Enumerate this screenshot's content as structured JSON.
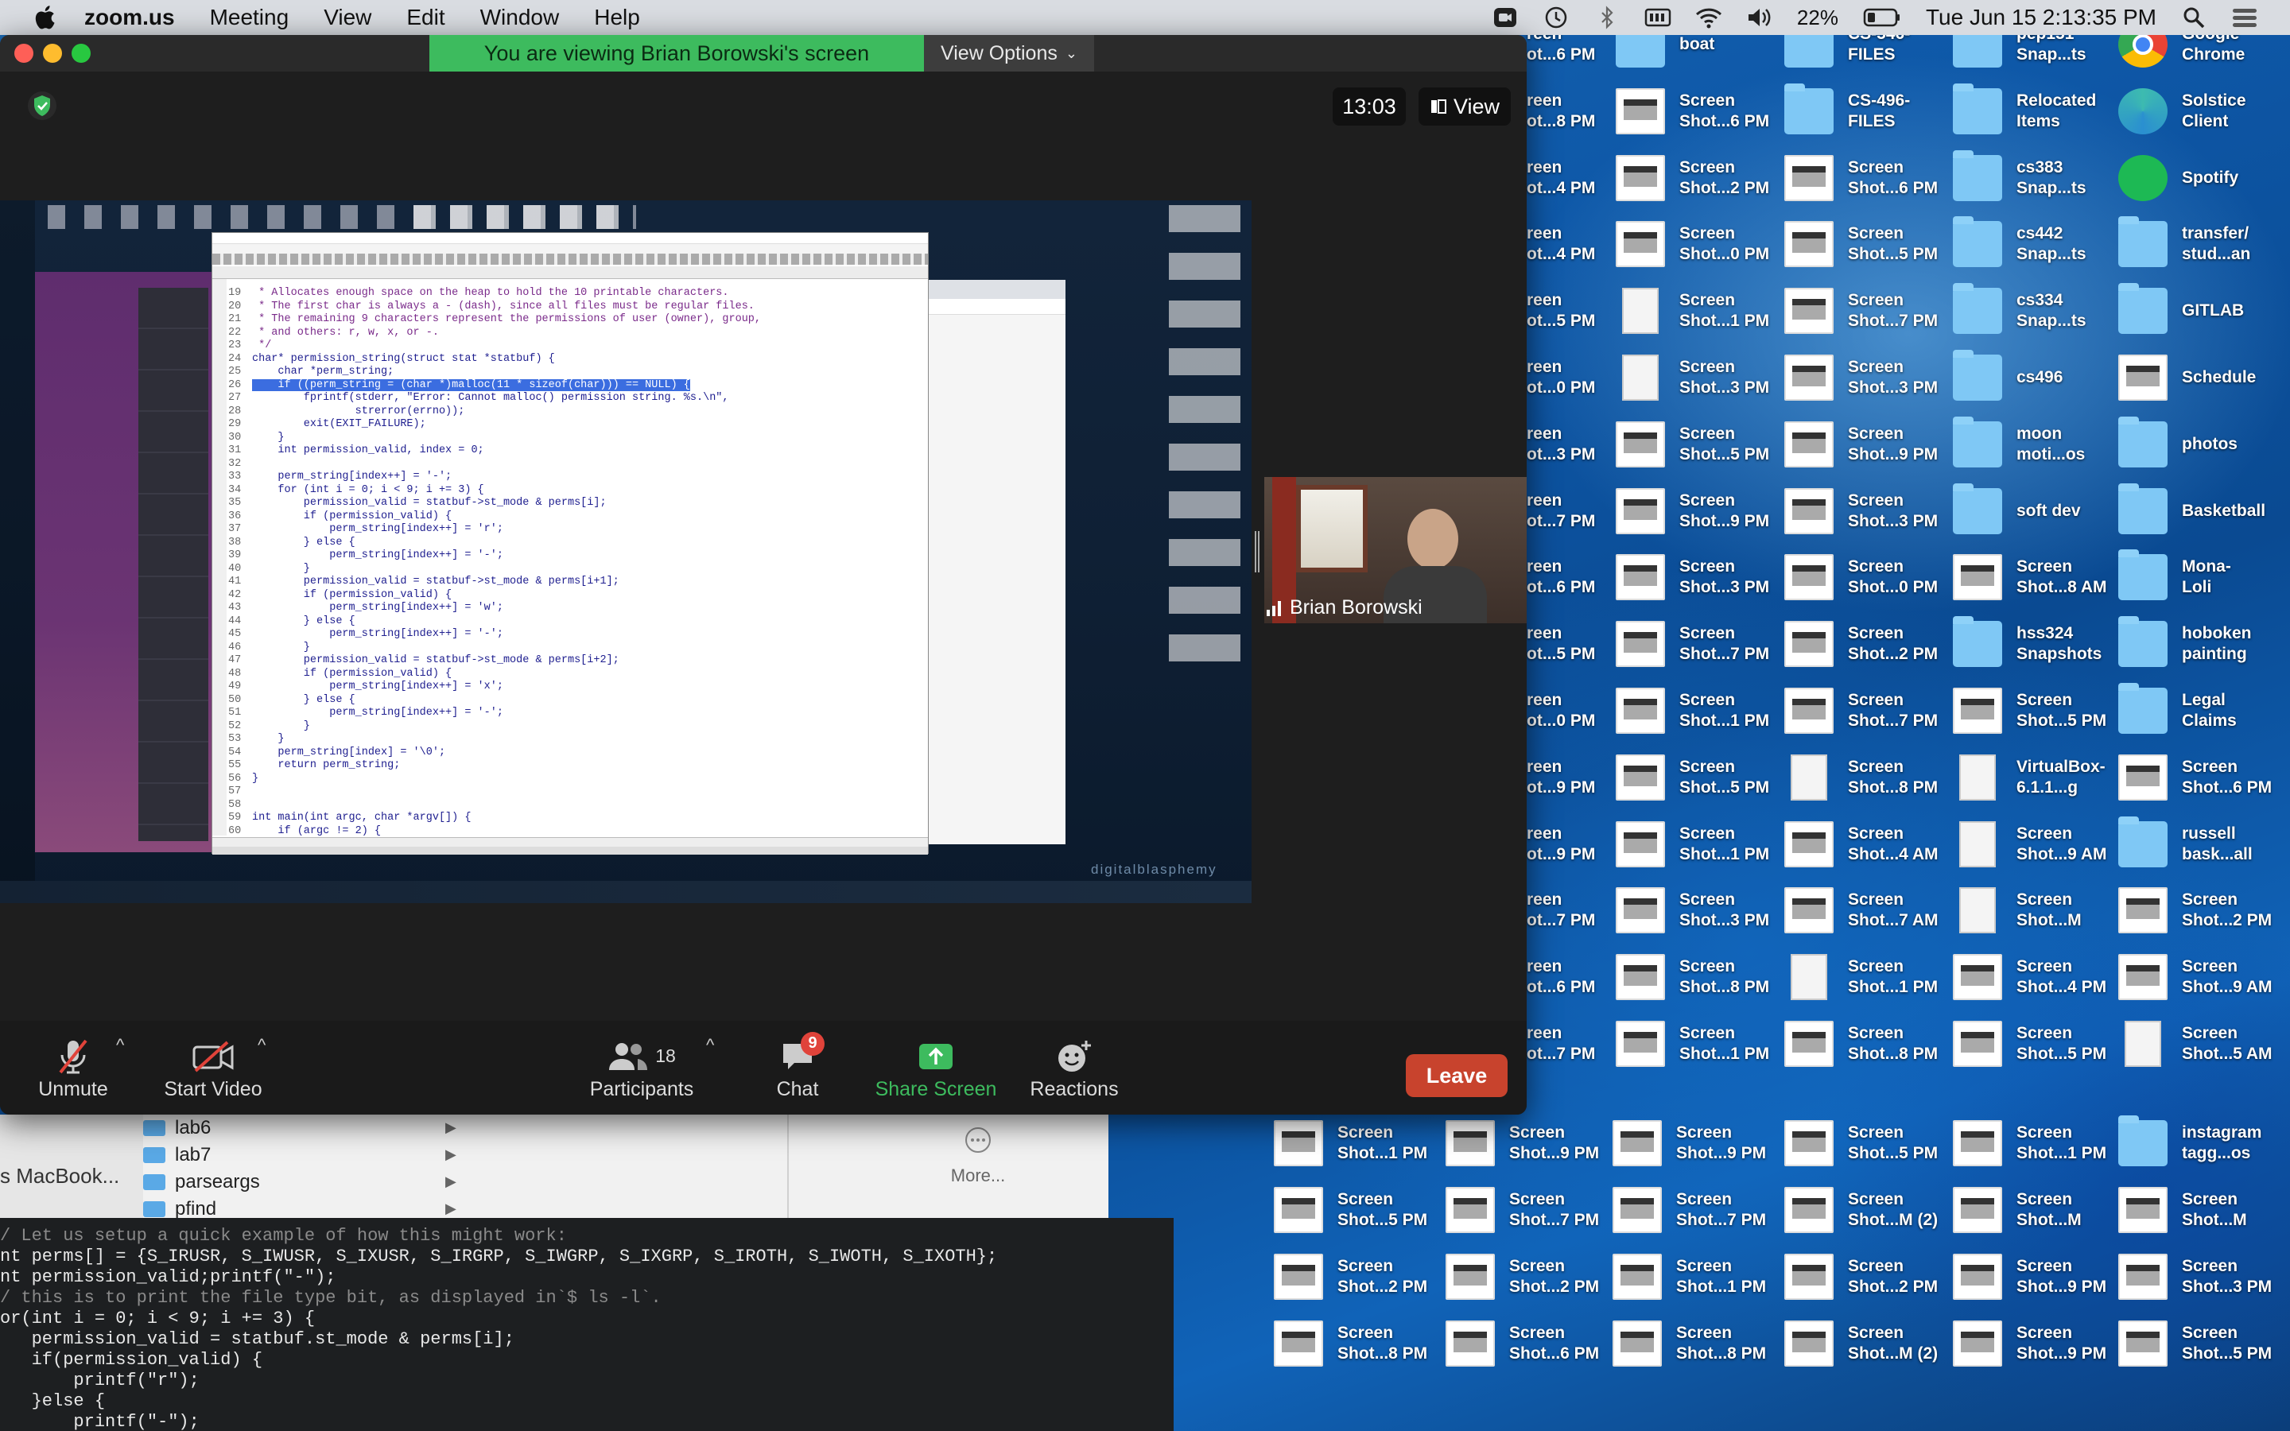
{
  "menubar": {
    "app": "zoom.us",
    "menus": [
      "Meeting",
      "View",
      "Edit",
      "Window",
      "Help"
    ],
    "battery": "22%",
    "datetime": "Tue Jun 15  2:13:35 PM"
  },
  "zoom": {
    "banner": "You are viewing Brian Borowski's screen",
    "view_options": "View Options",
    "timer": "13:03",
    "view_button": "View",
    "participant_name": "Brian Borowski",
    "toolbar": {
      "unmute": "Unmute",
      "start_video": "Start Video",
      "participants": "Participants",
      "participants_count": "18",
      "chat": "Chat",
      "chat_badge": "9",
      "share_screen": "Share Screen",
      "reactions": "Reactions",
      "leave": "Leave"
    },
    "shared_screen": {
      "watermark": "digitalblasphemy",
      "code_lines": [
        {
          "n": "19",
          "t": " * Allocates enough space on the heap to hold the 10 printable characters.",
          "c": "cm"
        },
        {
          "n": "20",
          "t": " * The first char is always a - (dash), since all files must be regular files.",
          "c": "cm"
        },
        {
          "n": "21",
          "t": " * The remaining 9 characters represent the permissions of user (owner), group,",
          "c": "cm"
        },
        {
          "n": "22",
          "t": " * and others: r, w, x, or -.",
          "c": "cm"
        },
        {
          "n": "23",
          "t": " */",
          "c": "cm"
        },
        {
          "n": "24",
          "t": "char* permission_string(struct stat *statbuf) {",
          "c": ""
        },
        {
          "n": "25",
          "t": "    char *perm_string;",
          "c": ""
        },
        {
          "n": "26",
          "t": "    if ((perm_string = (char *)malloc(11 * sizeof(char))) == NULL) {",
          "c": "hl"
        },
        {
          "n": "27",
          "t": "        fprintf(stderr, \"Error: Cannot malloc() permission string. %s.\\n\",",
          "c": ""
        },
        {
          "n": "28",
          "t": "                strerror(errno));",
          "c": ""
        },
        {
          "n": "29",
          "t": "        exit(EXIT_FAILURE);",
          "c": ""
        },
        {
          "n": "30",
          "t": "    }",
          "c": ""
        },
        {
          "n": "31",
          "t": "    int permission_valid, index = 0;",
          "c": ""
        },
        {
          "n": "32",
          "t": "",
          "c": ""
        },
        {
          "n": "33",
          "t": "    perm_string[index++] = '-';",
          "c": ""
        },
        {
          "n": "34",
          "t": "    for (int i = 0; i < 9; i += 3) {",
          "c": ""
        },
        {
          "n": "35",
          "t": "        permission_valid = statbuf->st_mode & perms[i];",
          "c": ""
        },
        {
          "n": "36",
          "t": "        if (permission_valid) {",
          "c": ""
        },
        {
          "n": "37",
          "t": "            perm_string[index++] = 'r';",
          "c": ""
        },
        {
          "n": "38",
          "t": "        } else {",
          "c": ""
        },
        {
          "n": "39",
          "t": "            perm_string[index++] = '-';",
          "c": ""
        },
        {
          "n": "40",
          "t": "        }",
          "c": ""
        },
        {
          "n": "41",
          "t": "        permission_valid = statbuf->st_mode & perms[i+1];",
          "c": ""
        },
        {
          "n": "42",
          "t": "        if (permission_valid) {",
          "c": ""
        },
        {
          "n": "43",
          "t": "            perm_string[index++] = 'w';",
          "c": ""
        },
        {
          "n": "44",
          "t": "        } else {",
          "c": ""
        },
        {
          "n": "45",
          "t": "            perm_string[index++] = '-';",
          "c": ""
        },
        {
          "n": "46",
          "t": "        }",
          "c": ""
        },
        {
          "n": "47",
          "t": "        permission_valid = statbuf->st_mode & perms[i+2];",
          "c": ""
        },
        {
          "n": "48",
          "t": "        if (permission_valid) {",
          "c": ""
        },
        {
          "n": "49",
          "t": "            perm_string[index++] = 'x';",
          "c": ""
        },
        {
          "n": "50",
          "t": "        } else {",
          "c": ""
        },
        {
          "n": "51",
          "t": "            perm_string[index++] = '-';",
          "c": ""
        },
        {
          "n": "52",
          "t": "        }",
          "c": ""
        },
        {
          "n": "53",
          "t": "    }",
          "c": ""
        },
        {
          "n": "54",
          "t": "    perm_string[index] = '\\0';",
          "c": ""
        },
        {
          "n": "55",
          "t": "    return perm_string;",
          "c": ""
        },
        {
          "n": "56",
          "t": "}",
          "c": ""
        },
        {
          "n": "57",
          "t": "",
          "c": ""
        },
        {
          "n": "58",
          "t": "",
          "c": ""
        },
        {
          "n": "59",
          "t": "int main(int argc, char *argv[]) {",
          "c": ""
        },
        {
          "n": "60",
          "t": "    if (argc != 2) {",
          "c": ""
        }
      ]
    }
  },
  "finder": {
    "items": [
      "lab6",
      "lab7",
      "parseargs",
      "pfind"
    ],
    "sidebar_text": "s MacBook...",
    "more": "More..."
  },
  "terminal": {
    "lines": [
      "/ Let us setup a quick example of how this might work:",
      "nt perms[] = {S_IRUSR, S_IWUSR, S_IXUSR, S_IRGRP, S_IWGRP, S_IXGRP, S_IROTH, S_IWOTH, S_IXOTH};",
      "nt permission_valid;printf(\"-\");",
      "/ this is to print the file type bit, as displayed in`$ ls -l`.",
      "or(int i = 0; i < 9; i += 3) {",
      "   permission_valid = statbuf.st_mode & perms[i];",
      "   if(permission_valid) {",
      "       printf(\"r\");",
      "   }else {",
      "       printf(\"-\");"
    ]
  },
  "desktop_icons": [
    {
      "label": "reen\not...6 PM",
      "type": "shot"
    },
    {
      "label": "boat",
      "type": "folder"
    },
    {
      "label": "CS-546-\nFILES",
      "type": "folder"
    },
    {
      "label": "pep151\nSnap...ts",
      "type": "folder"
    },
    {
      "label": "Google\nChrome",
      "type": "chrome"
    },
    {
      "label": "reen\not...8 PM",
      "type": "shot"
    },
    {
      "label": "Screen\nShot...6 PM",
      "type": "shot"
    },
    {
      "label": "CS-496-\nFILES",
      "type": "folder"
    },
    {
      "label": "Relocated\nItems",
      "type": "folder"
    },
    {
      "label": "Solstice\nClient",
      "type": "solstice"
    },
    {
      "label": "reen\not...4 PM",
      "type": "shot"
    },
    {
      "label": "Screen\nShot...2 PM",
      "type": "shot"
    },
    {
      "label": "Screen\nShot...6 PM",
      "type": "shot"
    },
    {
      "label": "cs383\nSnap...ts",
      "type": "folder"
    },
    {
      "label": "Spotify",
      "type": "spotify"
    },
    {
      "label": "reen\not...4 PM",
      "type": "shot"
    },
    {
      "label": "Screen\nShot...0 PM",
      "type": "shot"
    },
    {
      "label": "Screen\nShot...5 PM",
      "type": "shot"
    },
    {
      "label": "cs442\nSnap...ts",
      "type": "folder"
    },
    {
      "label": "transfer/\nstud...an",
      "type": "folder"
    },
    {
      "label": "reen\not...5 PM",
      "type": "shot"
    },
    {
      "label": "Screen\nShot...1 PM",
      "type": "doc"
    },
    {
      "label": "Screen\nShot...7 PM",
      "type": "shot"
    },
    {
      "label": "cs334\nSnap...ts",
      "type": "folder"
    },
    {
      "label": "GITLAB",
      "type": "folder"
    },
    {
      "label": "reen\not...0 PM",
      "type": "shot"
    },
    {
      "label": "Screen\nShot...3 PM",
      "type": "doc"
    },
    {
      "label": "Screen\nShot...3 PM",
      "type": "shot"
    },
    {
      "label": "cs496",
      "type": "folder"
    },
    {
      "label": "Schedule",
      "type": "shot"
    },
    {
      "label": "reen\not...3 PM",
      "type": "shot"
    },
    {
      "label": "Screen\nShot...5 PM",
      "type": "shot"
    },
    {
      "label": "Screen\nShot...9 PM",
      "type": "shot"
    },
    {
      "label": "moon\nmoti...os",
      "type": "folder"
    },
    {
      "label": "photos",
      "type": "folder"
    },
    {
      "label": "reen\not...7 PM",
      "type": "shot"
    },
    {
      "label": "Screen\nShot...9 PM",
      "type": "shot"
    },
    {
      "label": "Screen\nShot...3 PM",
      "type": "shot"
    },
    {
      "label": "soft dev",
      "type": "folder"
    },
    {
      "label": "Basketball",
      "type": "folder"
    },
    {
      "label": "reen\not...6 PM",
      "type": "shot"
    },
    {
      "label": "Screen\nShot...3 PM",
      "type": "shot"
    },
    {
      "label": "Screen\nShot...0 PM",
      "type": "shot"
    },
    {
      "label": "Screen\nShot...8 AM",
      "type": "shot"
    },
    {
      "label": "Mona-\nLoli",
      "type": "folder"
    },
    {
      "label": "reen\not...5 PM",
      "type": "shot"
    },
    {
      "label": "Screen\nShot...7 PM",
      "type": "shot"
    },
    {
      "label": "Screen\nShot...2 PM",
      "type": "shot"
    },
    {
      "label": "hss324\nSnapshots",
      "type": "folder"
    },
    {
      "label": "hoboken\npainting",
      "type": "folder"
    },
    {
      "label": "reen\not...0 PM",
      "type": "shot"
    },
    {
      "label": "Screen\nShot...1 PM",
      "type": "shot"
    },
    {
      "label": "Screen\nShot...7 PM",
      "type": "shot"
    },
    {
      "label": "Screen\nShot...5 PM",
      "type": "shot"
    },
    {
      "label": "Legal\nClaims",
      "type": "folder"
    },
    {
      "label": "reen\not...9 PM",
      "type": "shot"
    },
    {
      "label": "Screen\nShot...5 PM",
      "type": "shot"
    },
    {
      "label": "Screen\nShot...8 PM",
      "type": "doc"
    },
    {
      "label": "VirtualBox-\n6.1.1...g",
      "type": "doc"
    },
    {
      "label": "Screen\nShot...6 PM",
      "type": "shot"
    },
    {
      "label": "reen\not...9 PM",
      "type": "shot"
    },
    {
      "label": "Screen\nShot...1 PM",
      "type": "shot"
    },
    {
      "label": "Screen\nShot...4 AM",
      "type": "shot"
    },
    {
      "label": "Screen\nShot...9 AM",
      "type": "doc"
    },
    {
      "label": "russell\nbask...all",
      "type": "folder"
    },
    {
      "label": "reen\not...7 PM",
      "type": "shot"
    },
    {
      "label": "Screen\nShot...3 PM",
      "type": "shot"
    },
    {
      "label": "Screen\nShot...7 AM",
      "type": "shot"
    },
    {
      "label": "Screen\nShot...M",
      "type": "doc"
    },
    {
      "label": "Screen\nShot...2 PM",
      "type": "shot"
    },
    {
      "label": "reen\not...6 PM",
      "type": "shot"
    },
    {
      "label": "Screen\nShot...8 PM",
      "type": "shot"
    },
    {
      "label": "Screen\nShot...1 PM",
      "type": "doc"
    },
    {
      "label": "Screen\nShot...4 PM",
      "type": "shot"
    },
    {
      "label": "Screen\nShot...9 AM",
      "type": "shot"
    },
    {
      "label": "reen\not...7 PM",
      "type": "shot"
    },
    {
      "label": "Screen\nShot...1 PM",
      "type": "shot"
    },
    {
      "label": "Screen\nShot...8 PM",
      "type": "shot"
    },
    {
      "label": "Screen\nShot...5 PM",
      "type": "shot"
    },
    {
      "label": "Screen\nShot...5 AM",
      "type": "doc"
    },
    {
      "label": "Screen\nShot...1 PM",
      "type": "shot"
    },
    {
      "label": "Screen\nShot...9 PM",
      "type": "shot"
    },
    {
      "label": "Screen\nShot...9 PM",
      "type": "shot"
    },
    {
      "label": "Screen\nShot...5 PM",
      "type": "shot"
    },
    {
      "label": "Screen\nShot...1 PM",
      "type": "shot"
    },
    {
      "label": "instagram\ntagg...os",
      "type": "folder"
    },
    {
      "label": "Screen\nShot...5 PM",
      "type": "shot"
    },
    {
      "label": "Screen\nShot...7 PM",
      "type": "shot"
    },
    {
      "label": "Screen\nShot...7 PM",
      "type": "shot"
    },
    {
      "label": "Screen\nShot...M (2)",
      "type": "shot"
    },
    {
      "label": "Screen\nShot...M",
      "type": "shot"
    },
    {
      "label": "Screen\nShot...M",
      "type": "shot"
    },
    {
      "label": "Screen\nShot...2 PM",
      "type": "shot"
    },
    {
      "label": "Screen\nShot...2 PM",
      "type": "shot"
    },
    {
      "label": "Screen\nShot...1 PM",
      "type": "shot"
    },
    {
      "label": "Screen\nShot...2 PM",
      "type": "shot"
    },
    {
      "label": "Screen\nShot...9 PM",
      "type": "shot"
    },
    {
      "label": "Screen\nShot...3 PM",
      "type": "shot"
    },
    {
      "label": "Screen\nShot...8 PM",
      "type": "shot"
    },
    {
      "label": "Screen\nShot...6 PM",
      "type": "shot"
    },
    {
      "label": "Screen\nShot...8 PM",
      "type": "shot"
    },
    {
      "label": "Screen\nShot...M (2)",
      "type": "shot"
    },
    {
      "label": "Screen\nShot...9 PM",
      "type": "shot"
    },
    {
      "label": "Screen\nShot...5 PM",
      "type": "shot"
    }
  ],
  "colors": {
    "zoom_green": "#3dbb5e",
    "leave_red": "#c8432d",
    "menubar": "#d9dce1"
  }
}
